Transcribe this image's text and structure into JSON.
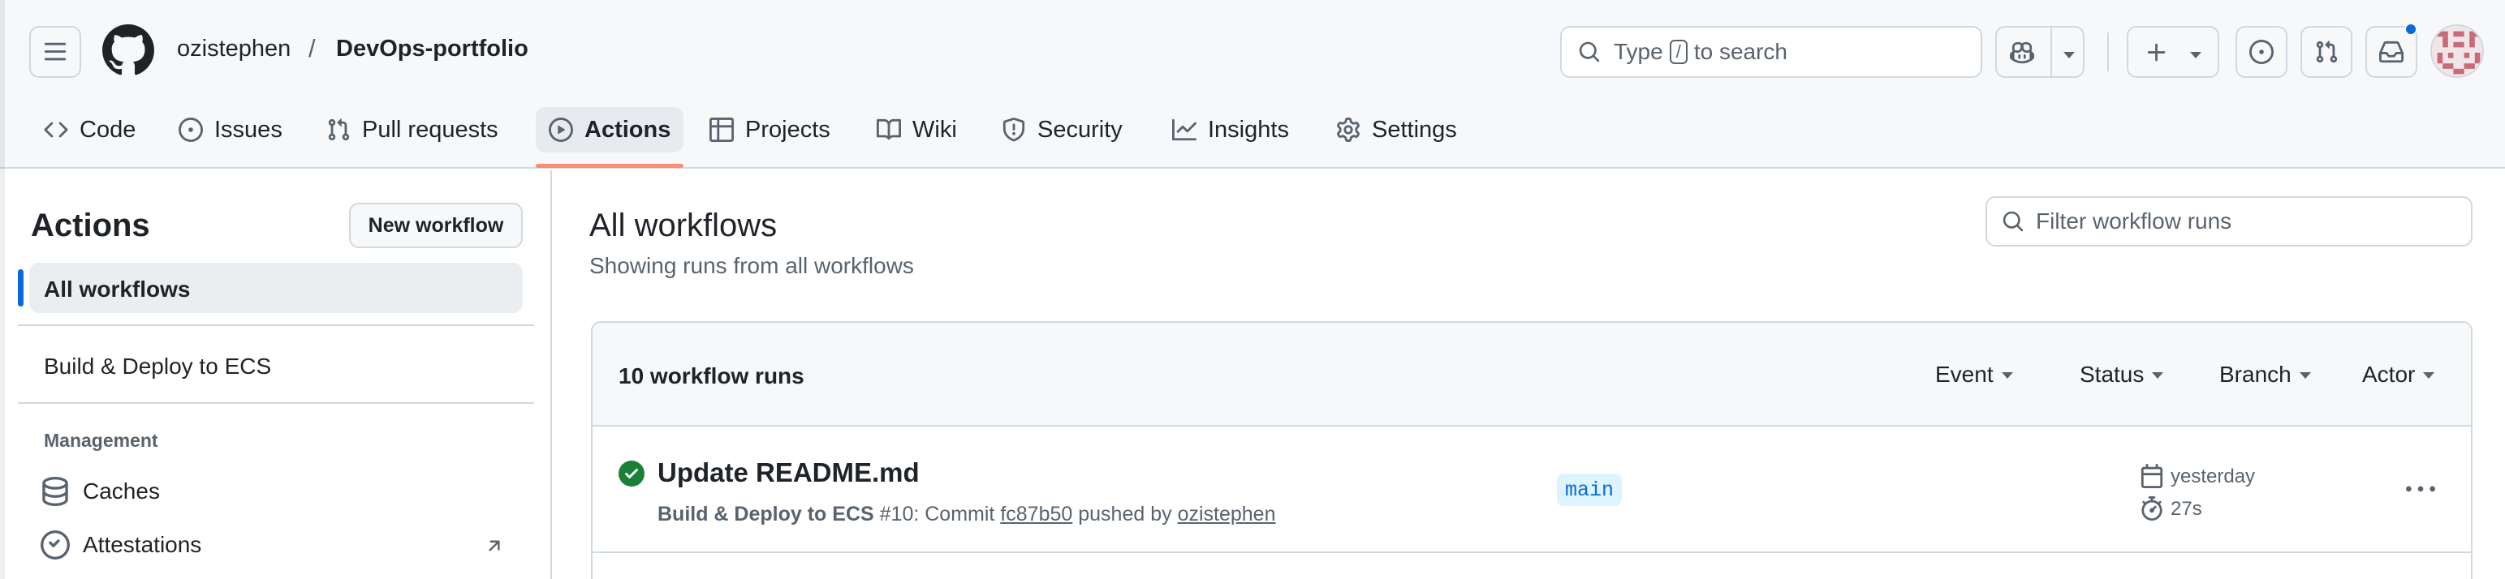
{
  "header": {
    "owner": "ozistephen",
    "separator": "/",
    "repo": "DevOps-portfolio",
    "search": {
      "prefix": "Type",
      "key": "/",
      "suffix": "to search"
    }
  },
  "tabs": [
    {
      "label": "Code",
      "icon": "code-icon"
    },
    {
      "label": "Issues",
      "icon": "issue-opened-icon"
    },
    {
      "label": "Pull requests",
      "icon": "git-pull-request-icon"
    },
    {
      "label": "Actions",
      "icon": "play-icon",
      "active": true
    },
    {
      "label": "Projects",
      "icon": "table-icon"
    },
    {
      "label": "Wiki",
      "icon": "book-icon"
    },
    {
      "label": "Security",
      "icon": "shield-icon"
    },
    {
      "label": "Insights",
      "icon": "graph-icon"
    },
    {
      "label": "Settings",
      "icon": "gear-icon"
    }
  ],
  "sidebar": {
    "title": "Actions",
    "new_workflow": "New workflow",
    "all_workflows": "All workflows",
    "workflow": "Build & Deploy to ECS",
    "management_heading": "Management",
    "caches": "Caches",
    "attestations": "Attestations"
  },
  "main": {
    "title": "All workflows",
    "subtitle": "Showing runs from all workflows",
    "filter_placeholder": "Filter workflow runs",
    "runs_count": "10 workflow runs",
    "filters": [
      "Event",
      "Status",
      "Branch",
      "Actor"
    ]
  },
  "runs": [
    {
      "title": "Update README.md",
      "workflow": "Build & Deploy to ECS",
      "run_number": "#10",
      "commit_prefix": ": Commit",
      "commit": "fc87b50",
      "pushed_by": "pushed by",
      "actor": "ozistephen",
      "branch": "main",
      "when": "yesterday",
      "duration": "27s",
      "status": "success"
    }
  ],
  "colors": {
    "accent": "#0969da",
    "success": "#1a7f37",
    "underline": "#fd8c73",
    "notification": "#0969da"
  }
}
